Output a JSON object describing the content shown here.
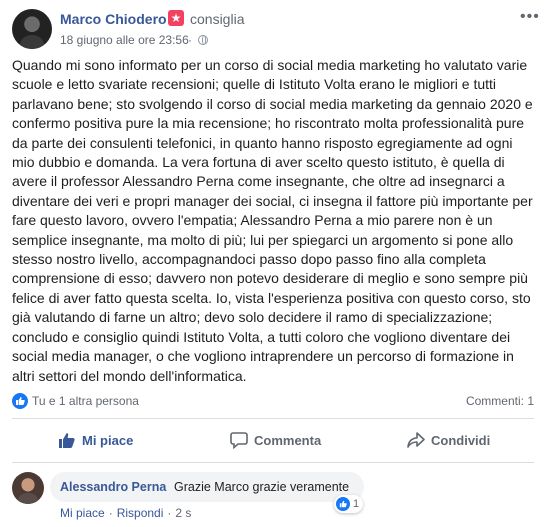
{
  "post": {
    "author": "Marco Chiodero",
    "recommendation_label": "consiglia",
    "date": "18 giugno alle ore 23:56",
    "date_separator": "·",
    "text": "Quando mi sono informato per un corso di social media marketing ho valutato varie scuole e letto svariate recensioni; quelle di Istituto Volta erano le migliori e tutti parlavano bene; sto svolgendo il corso di social media marketing da gennaio 2020 e confermo positiva pure la mia recensione; ho riscontrato molta professionalità pure da parte dei consulenti telefonici, in quanto hanno risposto egregiamente ad ogni mio dubbio e domanda. La vera fortuna di aver scelto questo istituto, è quella di avere il professor Alessandro Perna come insegnante, che oltre ad insegnarci a diventare dei veri e propri manager dei social, ci insegna il fattore più importante per fare questo lavoro, ovvero l'empatia; Alessandro Perna a mio parere non è un semplice insegnante, ma molto di più; lui per spiegarci un argomento si pone allo stesso nostro livello, accompagnandoci passo dopo passo fino alla completa comprensione di esso; davvero non potevo desiderare di meglio e sono sempre più felice di aver fatto questa scelta. Io, vista l'esperienza positiva con questo corso, sto già valutando di farne un altro; devo solo decidere il ramo di specializzazione; concludo e consiglio quindi Istituto Volta, a tutti coloro che vogliono diventare dei social media manager, o che vogliono intraprendere un percorso di formazione in altri settori del mondo dell'informatica.",
    "reactions_text": "Tu e 1 altra persona",
    "comments_count": "Commenti: 1"
  },
  "actions": {
    "like": "Mi piace",
    "comment": "Commenta",
    "share": "Condividi"
  },
  "comment": {
    "author": "Alessandro Perna",
    "text": "Grazie Marco grazie veramente",
    "like_count": "1",
    "like_action": "Mi piace",
    "separator": "·",
    "reply_action": "Rispondi",
    "time": "2 s"
  },
  "icons": {
    "more": "more-options-icon",
    "globe": "globe-icon",
    "recommend": "recommend-badge-icon",
    "like": "thumbs-up-icon",
    "comment": "comment-bubble-icon",
    "share": "share-arrow-icon"
  },
  "colors": {
    "link": "#385898",
    "like_blue": "#1877f2",
    "recommend_red": "#f3425f",
    "secondary_text": "#616770"
  }
}
